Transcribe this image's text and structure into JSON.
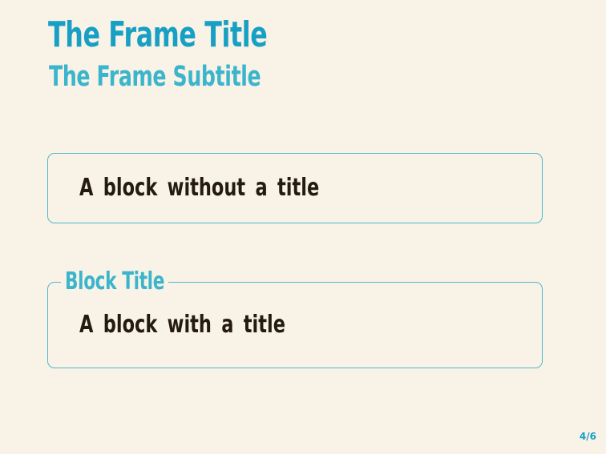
{
  "frame": {
    "title": "The Frame Title",
    "subtitle": "The Frame Subtitle"
  },
  "blocks": [
    {
      "title": "",
      "body": "A block without a title"
    },
    {
      "title": "Block Title",
      "body": "A block with a title"
    }
  ],
  "footer": {
    "page_number": "4/6"
  },
  "colors": {
    "background": "#f9f2e7",
    "title": "#17a0c4",
    "subtitle": "#3bb5cb",
    "block_border": "#4fb9cc",
    "body_text": "#241a10"
  }
}
